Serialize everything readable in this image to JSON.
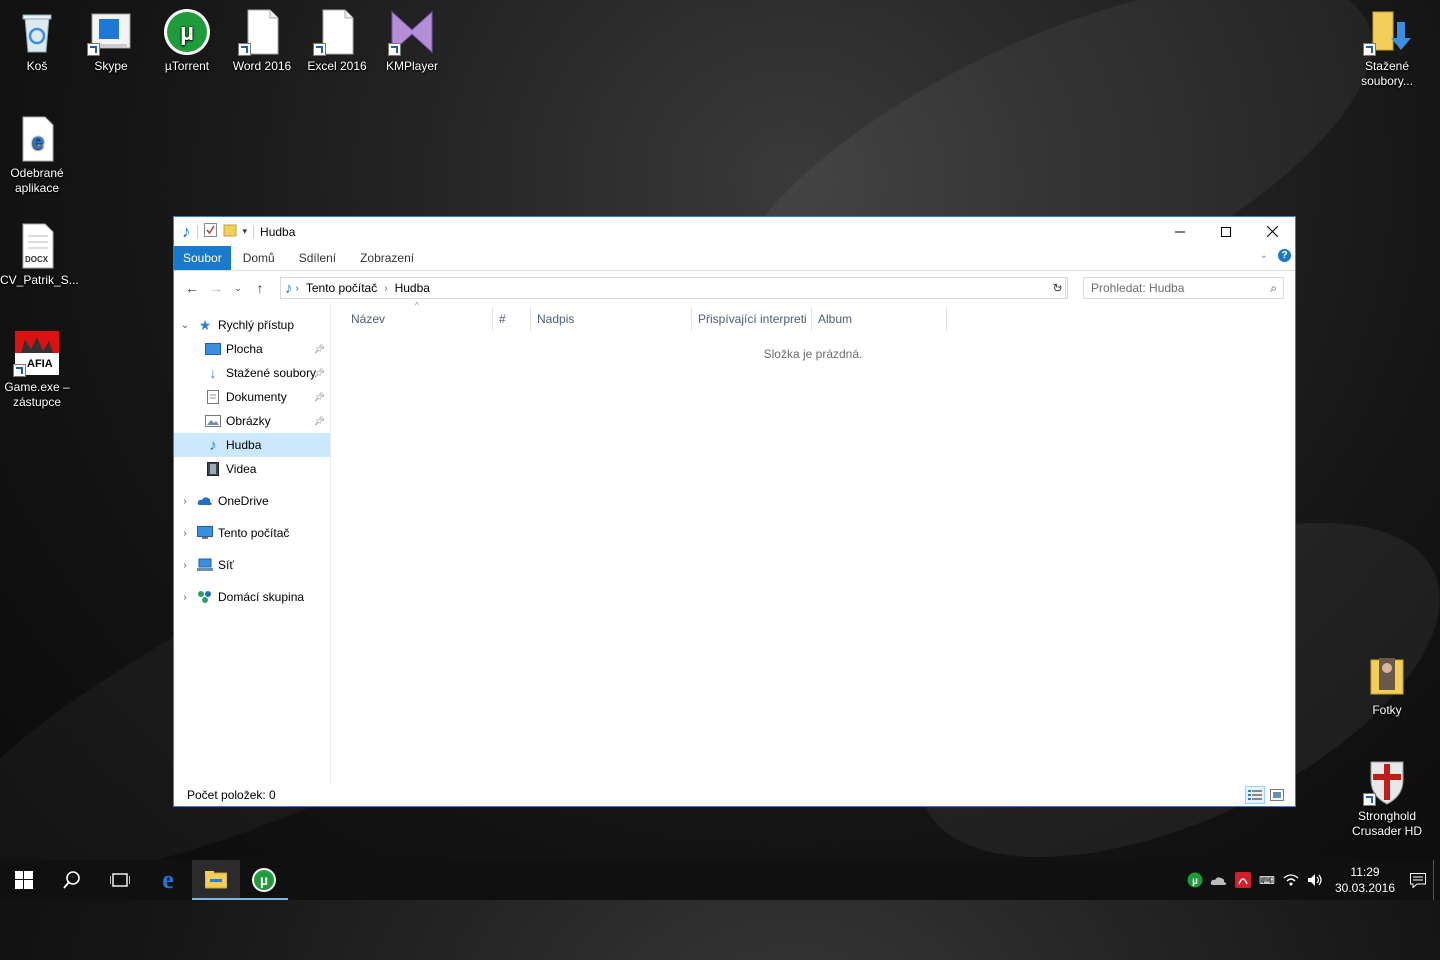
{
  "desktop": {
    "icons": [
      {
        "label": "Koš"
      },
      {
        "label": "Skype"
      },
      {
        "label": "µTorrent"
      },
      {
        "label": "Word 2016"
      },
      {
        "label": "Excel 2016"
      },
      {
        "label": "KMPlayer"
      },
      {
        "label": "Stažené soubory..."
      },
      {
        "label": "Odebrané aplikace"
      },
      {
        "label": "CV_Patrik_S..."
      },
      {
        "label": "Game.exe – zástupce"
      },
      {
        "label": "Fotky"
      },
      {
        "label": "Stronghold Crusader HD"
      }
    ],
    "docx_badge": "DOCX",
    "mafia_badge": "AFIA"
  },
  "window": {
    "title": "Hudba",
    "ribbon_tabs": [
      "Soubor",
      "Domů",
      "Sdílení",
      "Zobrazení"
    ],
    "help_label": "?",
    "breadcrumb": [
      "Tento počítač",
      "Hudba"
    ],
    "search_placeholder": "Prohledat: Hudba",
    "nav": {
      "quick_access": "Rychlý přístup",
      "items": [
        "Plocha",
        "Stažené soubory",
        "Dokumenty",
        "Obrázky",
        "Hudba",
        "Videa"
      ],
      "onedrive": "OneDrive",
      "this_pc": "Tento počítač",
      "network": "Síť",
      "homegroup": "Domácí skupina"
    },
    "columns": [
      "Název",
      "#",
      "Nadpis",
      "Přispívající interpreti",
      "Album"
    ],
    "empty_message": "Složka je prázdná.",
    "status": "Počet položek: 0"
  },
  "taskbar": {
    "time": "11:29",
    "date": "30.03.2016"
  },
  "colors": {
    "accent": "#1979ca",
    "selection": "#cce8ff",
    "taskbar": "#101010"
  }
}
